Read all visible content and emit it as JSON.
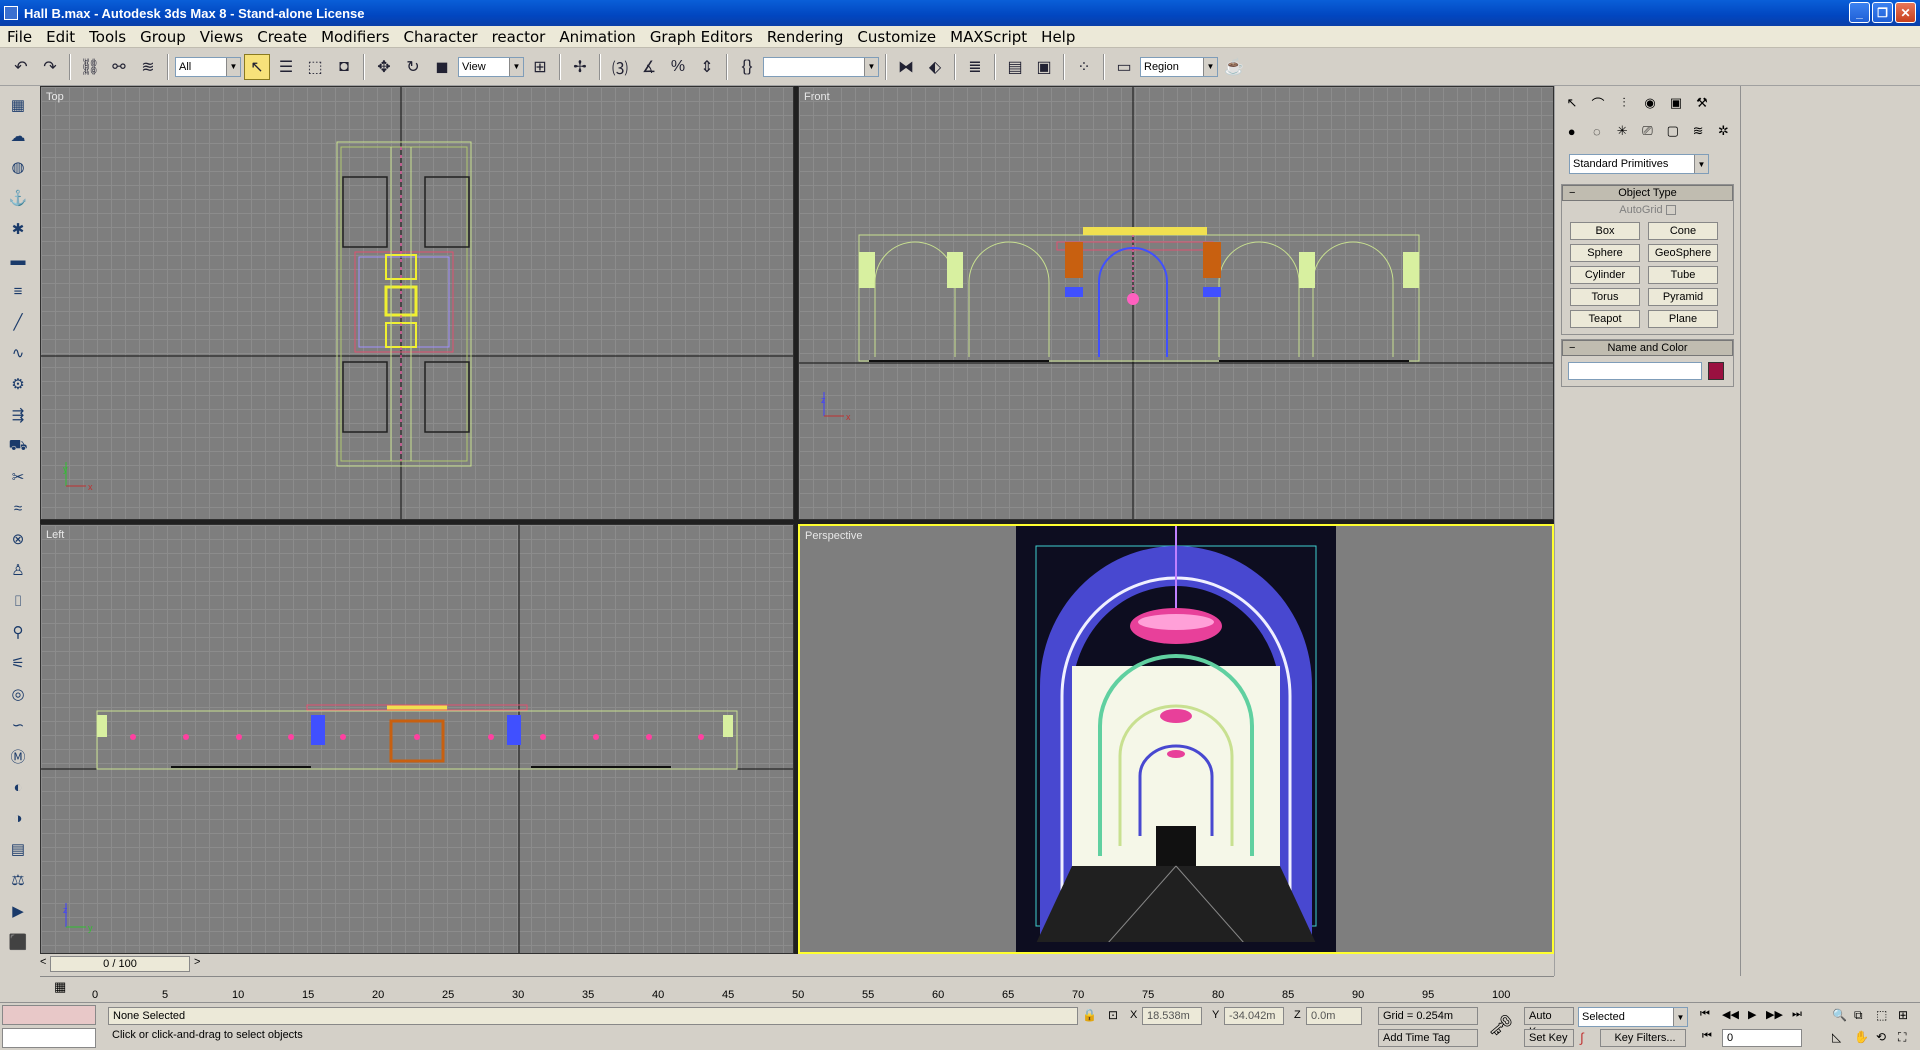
{
  "window": {
    "title": "Hall B.max - Autodesk 3ds Max 8  - Stand-alone License",
    "buttons": [
      "_",
      "❐",
      "✕"
    ]
  },
  "menu": [
    "File",
    "Edit",
    "Tools",
    "Group",
    "Views",
    "Create",
    "Modifiers",
    "Character",
    "reactor",
    "Animation",
    "Graph Editors",
    "Rendering",
    "Customize",
    "MAXScript",
    "Help"
  ],
  "toolbar": {
    "filter": "All",
    "refcoord": "View",
    "named_sel": "",
    "render_type": "Region"
  },
  "viewports": {
    "top": "Top",
    "front": "Front",
    "left": "Left",
    "persp": "Perspective"
  },
  "cmd": {
    "dropdown": "Standard Primitives",
    "object_type": "Object Type",
    "autogrid": "AutoGrid",
    "prims": [
      "Box",
      "Cone",
      "Sphere",
      "GeoSphere",
      "Cylinder",
      "Tube",
      "Torus",
      "Pyramid",
      "Teapot",
      "Plane"
    ],
    "name_color": "Name and Color",
    "swatch": "#9a1040"
  },
  "timeline": {
    "slider": "0 / 100",
    "ticks": [
      "0",
      "5",
      "10",
      "15",
      "20",
      "25",
      "30",
      "35",
      "40",
      "45",
      "50",
      "55",
      "60",
      "65",
      "70",
      "75",
      "80",
      "85",
      "90",
      "95",
      "100"
    ]
  },
  "status": {
    "selection": "None Selected",
    "prompt": "Click or click-and-drag to select objects",
    "x_label": "X",
    "x": "18.538m",
    "y_label": "Y",
    "y": "-34.042m",
    "z_label": "Z",
    "z": "0.0m",
    "grid": "Grid = 0.254m",
    "add_time_tag": "Add Time Tag",
    "auto_key": "Auto Key",
    "set_key": "Set Key",
    "key_mode": "Selected",
    "key_filters": "Key Filters...",
    "frame": "0"
  }
}
